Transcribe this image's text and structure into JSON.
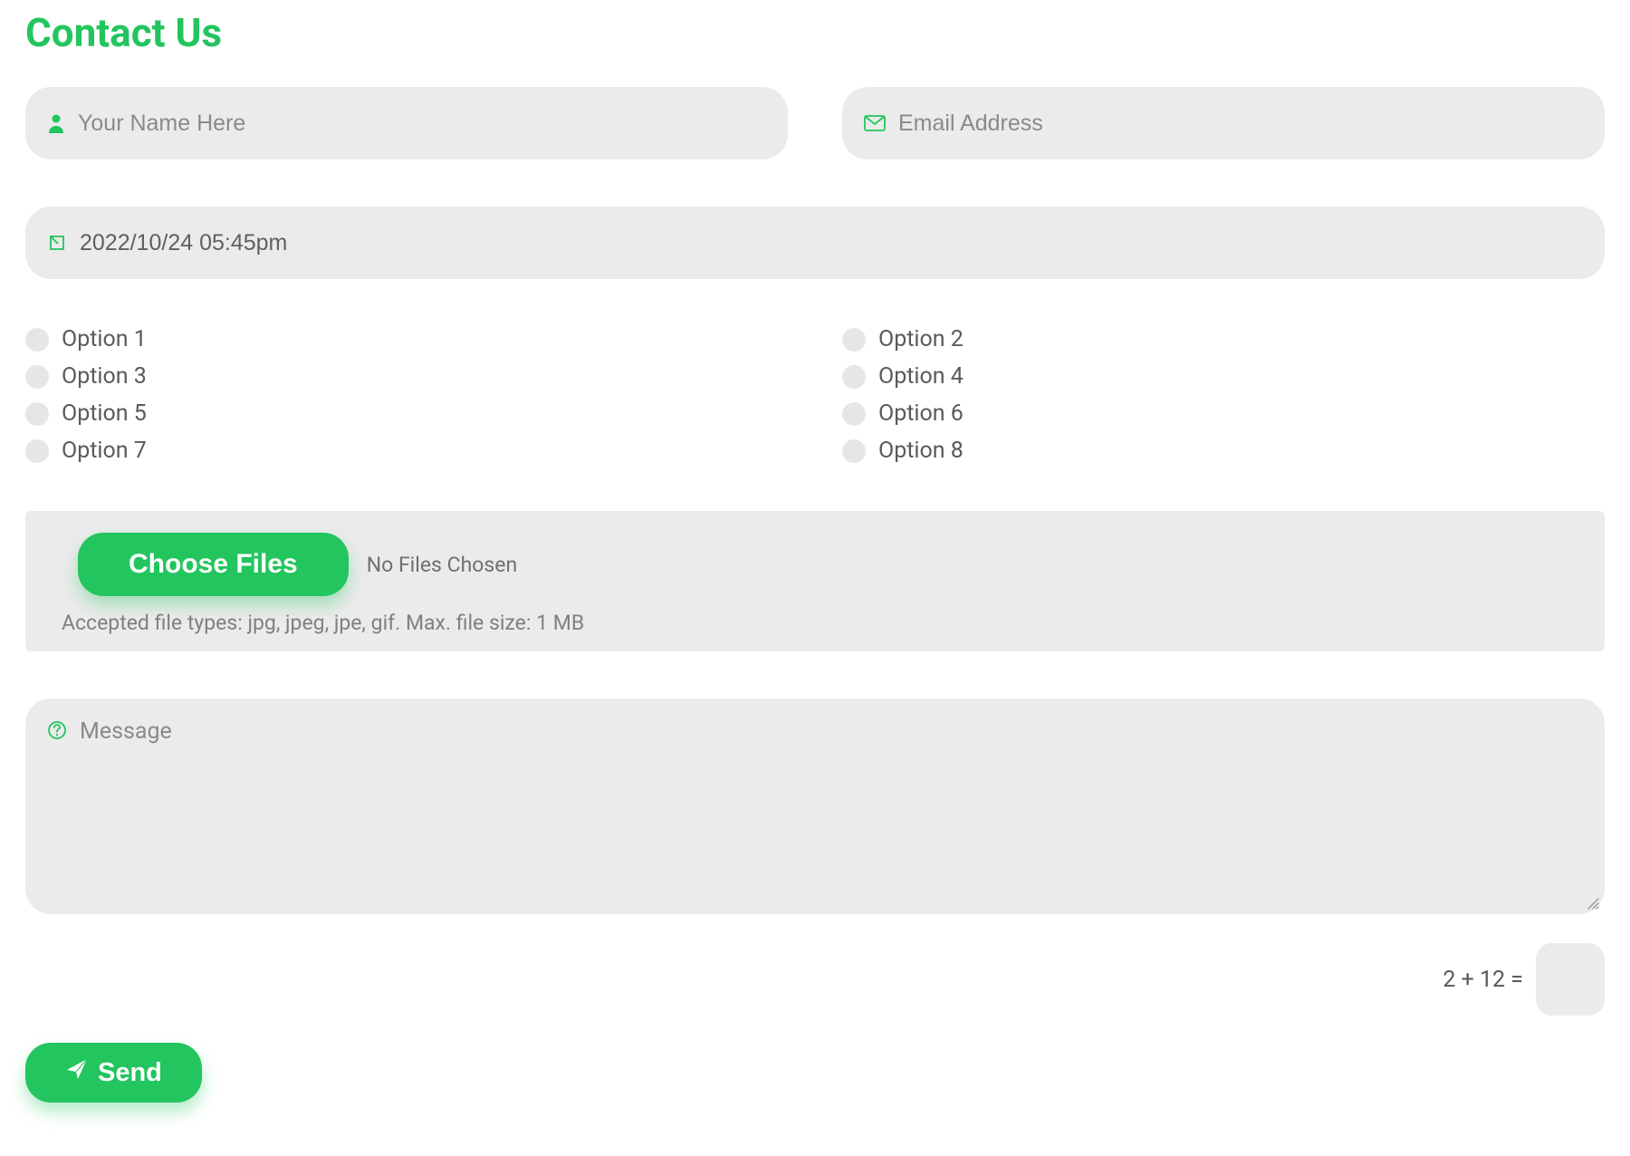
{
  "title": "Contact Us",
  "name": {
    "placeholder": "Your Name Here",
    "value": ""
  },
  "email": {
    "placeholder": "Email Address",
    "value": ""
  },
  "datetime": {
    "value": "2022/10/24 05:45pm"
  },
  "options": [
    {
      "label": "Option 1",
      "checked": false
    },
    {
      "label": "Option 2",
      "checked": false
    },
    {
      "label": "Option 3",
      "checked": false
    },
    {
      "label": "Option 4",
      "checked": false
    },
    {
      "label": "Option 5",
      "checked": false
    },
    {
      "label": "Option 6",
      "checked": false
    },
    {
      "label": "Option 7",
      "checked": false
    },
    {
      "label": "Option 8",
      "checked": false
    }
  ],
  "file": {
    "button_label": "Choose Files",
    "status": "No Files Chosen",
    "accepted": "Accepted file types: jpg, jpeg, jpe, gif. Max. file size: 1 MB"
  },
  "message": {
    "placeholder": "Message",
    "value": ""
  },
  "captcha": {
    "question": "2 + 12 =",
    "value": ""
  },
  "submit": {
    "label": "Send"
  },
  "colors": {
    "accent": "#22c55e",
    "field_bg": "#ebebeb"
  }
}
